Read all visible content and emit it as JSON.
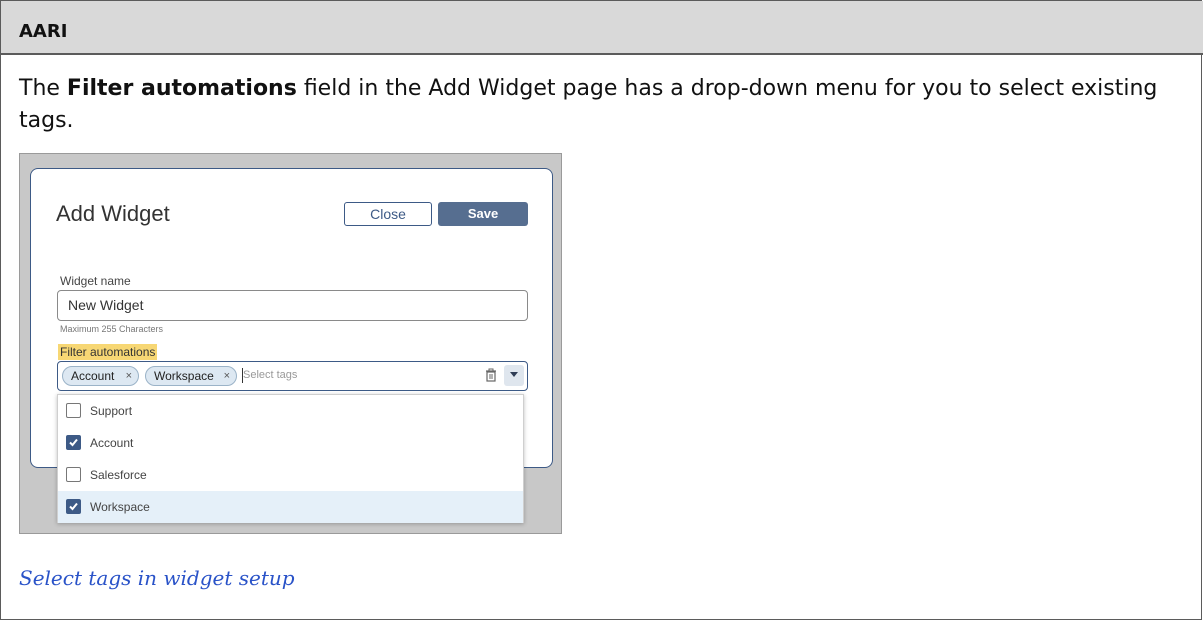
{
  "header": {
    "title": "AARI"
  },
  "intro": {
    "before": "The ",
    "bold": "Filter automations",
    "after": " field in the Add Widget page has a drop-down menu for you to select existing tags."
  },
  "widget_modal": {
    "title": "Add Widget",
    "close_label": "Close",
    "save_label": "Save",
    "name_label": "Widget name",
    "name_value": "New Widget",
    "name_hint": "Maximum 255 Characters",
    "filter_label": "Filter automations",
    "selected_tags": [
      "Account",
      "Workspace"
    ],
    "tags_placeholder": "Select tags",
    "options": [
      {
        "label": "Support",
        "checked": false
      },
      {
        "label": "Account",
        "checked": true
      },
      {
        "label": "Salesforce",
        "checked": false
      },
      {
        "label": "Workspace",
        "checked": true
      }
    ],
    "chip_remove_glyph": "×"
  },
  "caption": "Select tags in widget setup",
  "colors": {
    "accent": "#3d5a86",
    "save_button": "#566e90",
    "highlight": "#f7d774",
    "caption_link": "#2a53c8"
  }
}
